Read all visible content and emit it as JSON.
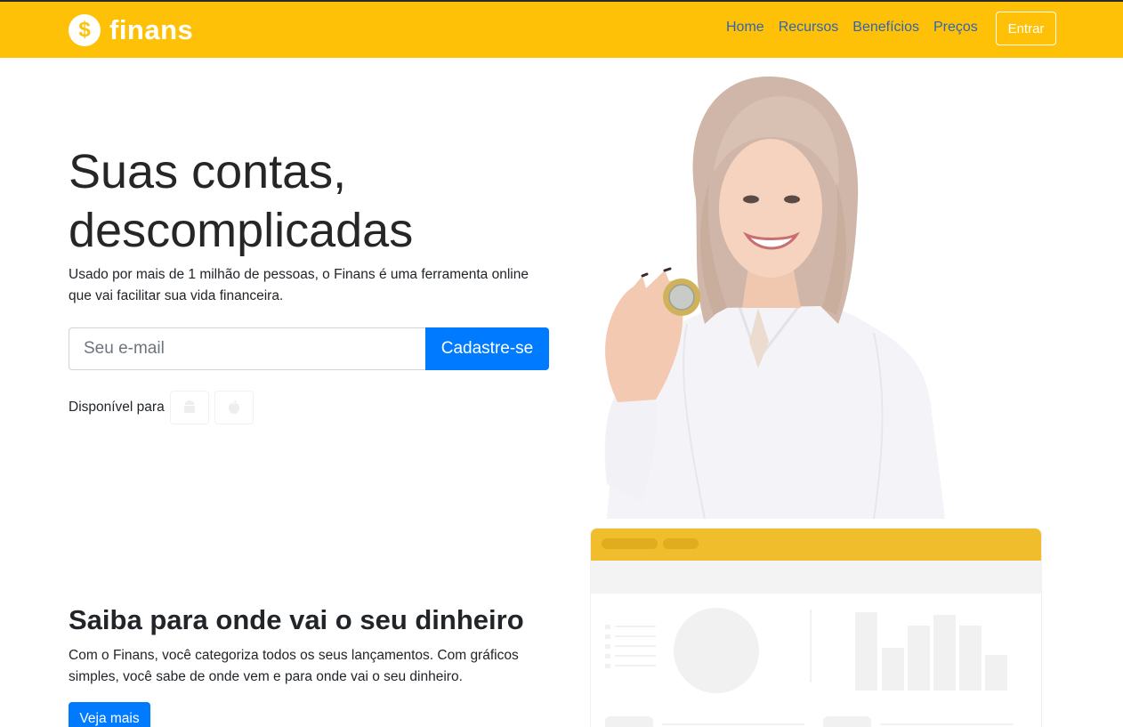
{
  "navbar": {
    "brand": "finans",
    "brand_icon": "dollar-coin-icon",
    "links": [
      "Home",
      "Recursos",
      "Benefícios",
      "Preços"
    ],
    "login_label": "Entrar"
  },
  "hero": {
    "title_line1": "Suas contas,",
    "title_line2": "descomplicadas",
    "text": "Usado por mais de 1 milhão de pessoas, o Finans é uma ferramenta online que vai facilitar sua vida financeira.",
    "email_placeholder": "Seu e-mail",
    "signup_label": "Cadastre-se",
    "available_label": "Disponível para",
    "store_icons": [
      "android-icon",
      "apple-icon"
    ]
  },
  "section": {
    "title": "Saiba para onde vai o seu dinheiro",
    "text": "Com o Finans, você categoriza todos os seus lançamentos. Com gráficos simples, você sabe de onde vem e para onde vai o seu dinheiro.",
    "button_label": "Veja mais"
  },
  "colors": {
    "navbar": "#ffc107",
    "primary": "#007bff",
    "link": "#2f66b3",
    "dashboard_header": "#f0bd2c"
  }
}
